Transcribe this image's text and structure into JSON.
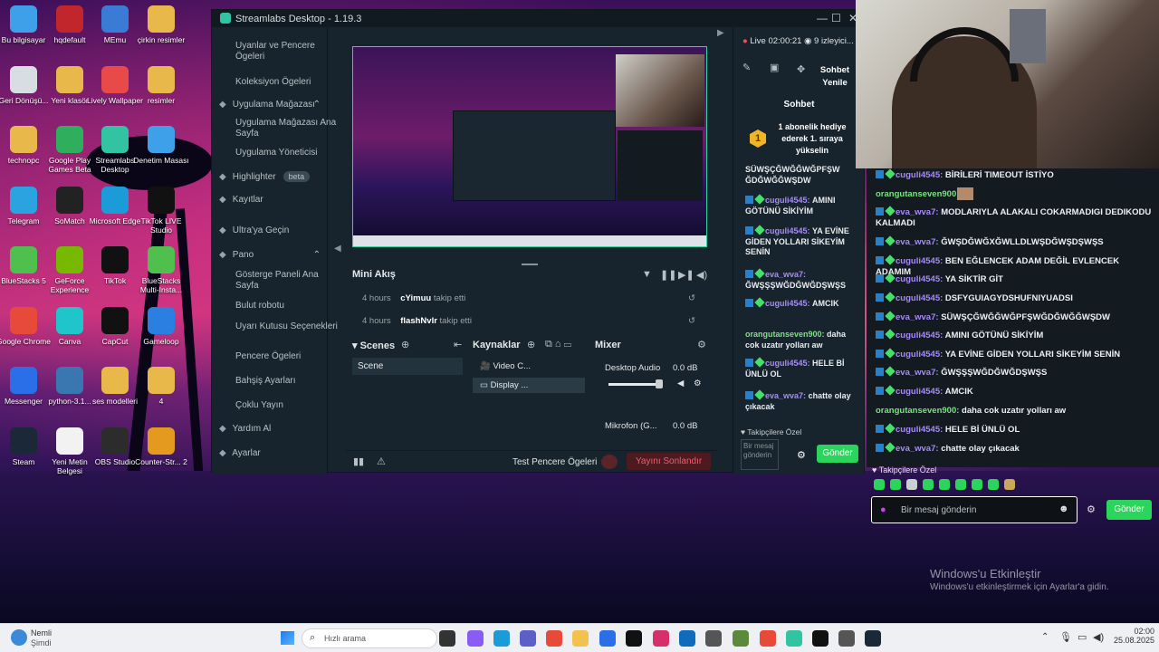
{
  "desktop": {
    "icons": [
      {
        "label": "Bu bilgisayar",
        "icon": "monitor-icon",
        "color": "#3da0e8"
      },
      {
        "label": "hqdefault",
        "icon": "image-file-icon",
        "color": "#c0262c"
      },
      {
        "label": "MEmu",
        "icon": "memu-icon",
        "color": "#3a7bd5"
      },
      {
        "label": "çirkin resimler",
        "icon": "folder-icon",
        "color": "#e8b84a"
      },
      {
        "label": "Geri Dönüşü...",
        "icon": "recycle-bin-icon",
        "color": "#d7dde3"
      },
      {
        "label": "Yeni klasör",
        "icon": "folder-icon",
        "color": "#e8b84a"
      },
      {
        "label": "Lively Wallpaper",
        "icon": "lively-icon",
        "color": "#e84a4a"
      },
      {
        "label": "resimler",
        "icon": "folder-icon",
        "color": "#e8b84a"
      },
      {
        "label": "technopc",
        "icon": "folder-icon",
        "color": "#e8b84a"
      },
      {
        "label": "Google Play Games Beta",
        "icon": "play-games-icon",
        "color": "#2fae5b"
      },
      {
        "label": "Streamlabs Desktop",
        "icon": "streamlabs-icon",
        "color": "#31c3a2"
      },
      {
        "label": "Denetim Masası",
        "icon": "control-panel-icon",
        "color": "#3da0e8"
      },
      {
        "label": "Telegram",
        "icon": "telegram-icon",
        "color": "#2aa3e0"
      },
      {
        "label": "SoMatch",
        "icon": "somatch-icon",
        "color": "#222222"
      },
      {
        "label": "Microsoft Edge",
        "icon": "edge-icon",
        "color": "#1b9bd7"
      },
      {
        "label": "TikTok LIVE Studio",
        "icon": "tiktok-icon",
        "color": "#111111"
      },
      {
        "label": "BlueStacks 5",
        "icon": "bluestacks-icon",
        "color": "#4fc04d"
      },
      {
        "label": "GeForce Experience",
        "icon": "geforce-icon",
        "color": "#76b900"
      },
      {
        "label": "TikTok",
        "icon": "tiktok-icon",
        "color": "#111111"
      },
      {
        "label": "BlueStacks Multi-Insta...",
        "icon": "bluestacks-icon",
        "color": "#4fc04d"
      },
      {
        "label": "Google Chrome",
        "icon": "chrome-icon",
        "color": "#e84a3a"
      },
      {
        "label": "Canva",
        "icon": "canva-icon",
        "color": "#20c4cb"
      },
      {
        "label": "CapCut",
        "icon": "capcut-icon",
        "color": "#111111"
      },
      {
        "label": "Gameloop",
        "icon": "gameloop-icon",
        "color": "#2a7fe0"
      },
      {
        "label": "Messenger",
        "icon": "messenger-icon",
        "color": "#2a6fe8"
      },
      {
        "label": "python-3.1...",
        "icon": "python-icon",
        "color": "#3a76b0"
      },
      {
        "label": "ses modelleri",
        "icon": "folder-icon",
        "color": "#e8b84a"
      },
      {
        "label": "4",
        "icon": "folder-icon",
        "color": "#e8b84a"
      },
      {
        "label": "Steam",
        "icon": "steam-icon",
        "color": "#1b2838"
      },
      {
        "label": "Yeni Metin Belgesi",
        "icon": "text-file-icon",
        "color": "#f2f2f2"
      },
      {
        "label": "OBS Studio",
        "icon": "obs-icon",
        "color": "#2c2c2c"
      },
      {
        "label": "Counter-Str... 2",
        "icon": "cs2-icon",
        "color": "#e39a1e"
      }
    ]
  },
  "streamlabs": {
    "title": "Streamlabs Desktop - 1.19.3",
    "sidebar": {
      "items": [
        {
          "label": "Uyanlar ve Pencere Ögeleri",
          "sub": true
        },
        {
          "label": "Koleksiyon Ögeleri",
          "sub": true
        },
        {
          "label": "Uygulama Mağazası",
          "sub": false,
          "icon": "store-icon"
        },
        {
          "label": "Uygulama Mağazası Ana Sayfa",
          "sub": true
        },
        {
          "label": "Uygulama Yöneticisi",
          "sub": true
        },
        {
          "label": "Highlighter",
          "badge": "beta",
          "sub": false,
          "icon": "highlighter-icon"
        },
        {
          "label": "Kayıtlar",
          "sub": false,
          "icon": "recordings-icon"
        },
        {
          "label": "Ultra'ya Geçin",
          "sub": false,
          "icon": "ultra-icon"
        },
        {
          "label": "Pano",
          "sub": false,
          "icon": "dashboard-icon"
        },
        {
          "label": "Gösterge Paneli Ana Sayfa",
          "sub": true
        },
        {
          "label": "Bulut robotu",
          "sub": true
        },
        {
          "label": "Uyarı Kutusu Seçenekleri",
          "sub": true
        },
        {
          "label": "Pencere Ögeleri",
          "sub": true
        },
        {
          "label": "Bahşiş Ayarları",
          "sub": true
        },
        {
          "label": "Çoklu Yayın",
          "sub": true
        },
        {
          "label": "Yardım Al",
          "sub": false,
          "icon": "help-icon"
        },
        {
          "label": "Ayarlar",
          "sub": false,
          "icon": "gear-icon"
        }
      ]
    },
    "mini_feed": {
      "title": "Mini Akış",
      "events": [
        {
          "time": "4 hours",
          "user": "cYimuu",
          "action": "takip etti"
        },
        {
          "time": "4 hours",
          "user": "flashNvlr",
          "action": "takip etti"
        }
      ]
    },
    "scenes": {
      "title": "Scenes",
      "items": [
        "Scene"
      ]
    },
    "sources": {
      "title": "Kaynaklar",
      "items": [
        "Video C...",
        "Display ..."
      ]
    },
    "mixer": {
      "title": "Mixer",
      "channels": [
        {
          "name": "Desktop Audio",
          "db": "0.0 dB"
        },
        {
          "name": "Mikrofon (G...",
          "db": "0.0 dB"
        }
      ]
    },
    "footer": {
      "test_label": "Test Pencere Ögeleri",
      "go_live_label": "Yayını Sonlandır"
    },
    "status": {
      "live_time": "Live 02:00:21",
      "viewers": "9 izleyici..."
    },
    "chat": {
      "refresh_label": "Sohbet Yenile",
      "tab_label": "Sohbet",
      "goal_rank": "1",
      "goal_text": "1 abonelik hediye ederek 1. sıraya yükselin",
      "messages": [
        {
          "user": "",
          "text": "SÜWŞÇĞWĞĞWĞPFŞW ĞDĞWĞĞWŞDW"
        },
        {
          "user": "cuguli4545:",
          "text": "AMINI GÖTÜNÜ SİKİYİM"
        },
        {
          "user": "cuguli4545:",
          "text": "YA EVİNE GİDEN YOLLARI SİKEYİM SENİN"
        },
        {
          "user": "eva_wva7:",
          "text": "ĞWŞŞŞWĞDĞWĞDŞWŞS"
        },
        {
          "user": "cuguli4545:",
          "text": "AMCIK"
        },
        {
          "user": "orangutanseven900:",
          "text": "daha cok uzatır yolları aw"
        },
        {
          "user": "cuguli4545:",
          "text": "HELE Bİ ÜNLÜ OL"
        },
        {
          "user": "eva_wva7:",
          "text": "chatte olay çıkacak"
        }
      ],
      "followers_label": "Takipçilere Özel",
      "input_placeholder": "Bir mesaj gönderin",
      "send_label": "Gönder"
    }
  },
  "stream_overlay_chat": {
    "messages": [
      {
        "user": "cuguli4545:",
        "text": "BİRİLERİ TIMEOUT İSTİYO",
        "color": "#a78bfa"
      },
      {
        "user": "orangutanseven900:",
        "text": "",
        "color": "#7ee083"
      },
      {
        "user": "eva_wva7:",
        "text": "MODLARIYLA ALAKALI COKARMADIGI DEDIKODU KALMADI",
        "color": "#a78bfa"
      },
      {
        "user": "eva_wva7:",
        "text": "ĞWŞDĞWĞXĞWLLDLWŞDĞWŞDŞWŞS",
        "color": "#a78bfa"
      },
      {
        "user": "cuguli4545:",
        "text": "BEN EĞLENCEK ADAM DEĞİL EVLENCEK ADAMIM",
        "color": "#a78bfa"
      },
      {
        "user": "cuguli4545:",
        "text": "YA SİKTİR GİT",
        "color": "#a78bfa"
      },
      {
        "user": "cuguli4545:",
        "text": "DSFYGUIAGYDSHUFNIYUADSI",
        "color": "#a78bfa"
      },
      {
        "user": "eva_wva7:",
        "text": "SÜWŞÇĞWĞĞWĞPFŞWĞDĞWĞĞWŞDW",
        "color": "#a78bfa"
      },
      {
        "user": "cuguli4545:",
        "text": "AMINI GÖTÜNÜ SİKİYİM",
        "color": "#a78bfa"
      },
      {
        "user": "cuguli4545:",
        "text": "YA EVİNE GİDEN YOLLARI SİKEYİM SENİN",
        "color": "#a78bfa"
      },
      {
        "user": "eva_wva7:",
        "text": "ĞWŞŞŞWĞDĞWĞDŞWŞS",
        "color": "#a78bfa"
      },
      {
        "user": "cuguli4545:",
        "text": "AMCIK",
        "color": "#a78bfa"
      },
      {
        "user": "orangutanseven900:",
        "text": "daha cok uzatır yolları aw",
        "color": "#7ee083"
      },
      {
        "user": "cuguli4545:",
        "text": "HELE Bİ ÜNLÜ OL",
        "color": "#a78bfa"
      },
      {
        "user": "eva_wva7:",
        "text": "chatte olay çıkacak",
        "color": "#a78bfa"
      }
    ],
    "followers_label": "Takipçilere Özel",
    "input_placeholder": "Bir mesaj gönderin",
    "send_label": "Gönder"
  },
  "activation": {
    "title": "Windows'u Etkinleştir",
    "subtitle": "Windows'u etkinleştirmek için Ayarlar'a gidin."
  },
  "taskbar": {
    "weather_temp": "Nemli",
    "weather_sub": "Şimdi",
    "search_placeholder": "Hızlı arama",
    "time": "02:00",
    "date": "25.08.2025"
  }
}
